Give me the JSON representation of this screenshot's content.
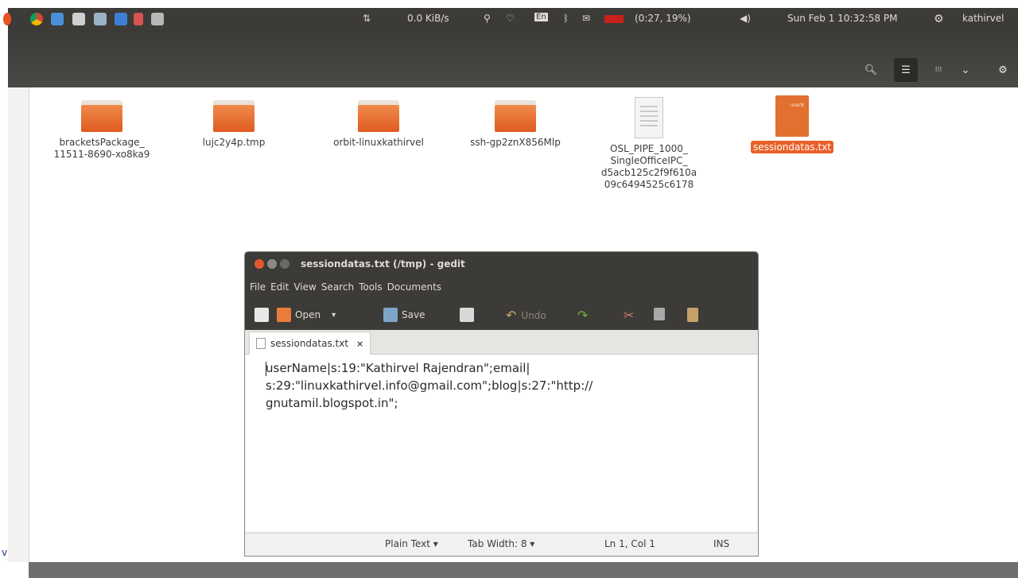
{
  "top_panel": {
    "network_speed": "0.0 KiB/s",
    "keyboard_layout": "En",
    "battery": "(0:27, 19%)",
    "datetime": "Sun Feb 1 10:32:58 PM",
    "user": "kathirvel",
    "icons": [
      "ubuntu-logo-icon",
      "chrome-icon",
      "document-icon",
      "camera-icon",
      "system-monitor-icon",
      "screenshot-icon",
      "transfer-icon",
      "game-icon",
      "network-arrows-icon",
      "accessibility-icon",
      "wifi-icon",
      "bluetooth-icon",
      "mail-icon",
      "battery-icon",
      "volume-icon",
      "settings-gear-icon"
    ]
  },
  "header_bar": {
    "buttons": [
      "search-icon",
      "list-view-icon",
      "grid-view-icon",
      "chevron-down-icon",
      "settings-icon"
    ]
  },
  "files": [
    {
      "name": "bracketsPackage_\n11511-8690-xo8ka9",
      "kind": "folder"
    },
    {
      "name": "lujc2y4p.tmp",
      "kind": "folder"
    },
    {
      "name": "orbit-linuxkathirvel",
      "kind": "folder"
    },
    {
      "name": "ssh-gp2znX856Mlp",
      "kind": "folder"
    },
    {
      "name": "OSL_PIPE_1000_\nSingleOfficeIPC_\nd5acb125c2f9f610a\n09c6494525c6178",
      "kind": "document"
    },
    {
      "name": "sessiondatas.txt",
      "kind": "text",
      "selected": true,
      "thumbnail_text": "userN"
    }
  ],
  "gedit": {
    "title": "sessiondatas.txt (/tmp) - gedit",
    "menu": [
      "File",
      "Edit",
      "View",
      "Search",
      "Tools",
      "Documents"
    ],
    "toolbar": {
      "open": "Open",
      "open_arrow": "▾",
      "save": "Save",
      "undo": "Undo"
    },
    "tab_label": "sessiondatas.txt",
    "tab_close": "×",
    "content": "userName|s:19:\"Kathirvel Rajendran\";email|\ns:29:\"linuxkathirvel.info@gmail.com\";blog|s:27:\"http://\ngnutamil.blogspot.in\";",
    "status": {
      "language": "Plain Text ▾",
      "tab_width": "Tab Width: 8 ▾",
      "position": "Ln 1, Col 1",
      "mode": "INS"
    }
  },
  "corner_text": "v",
  "colors": {
    "panel": "#3c3b37",
    "accent": "#e9602a",
    "folder": "#e96b2e"
  }
}
